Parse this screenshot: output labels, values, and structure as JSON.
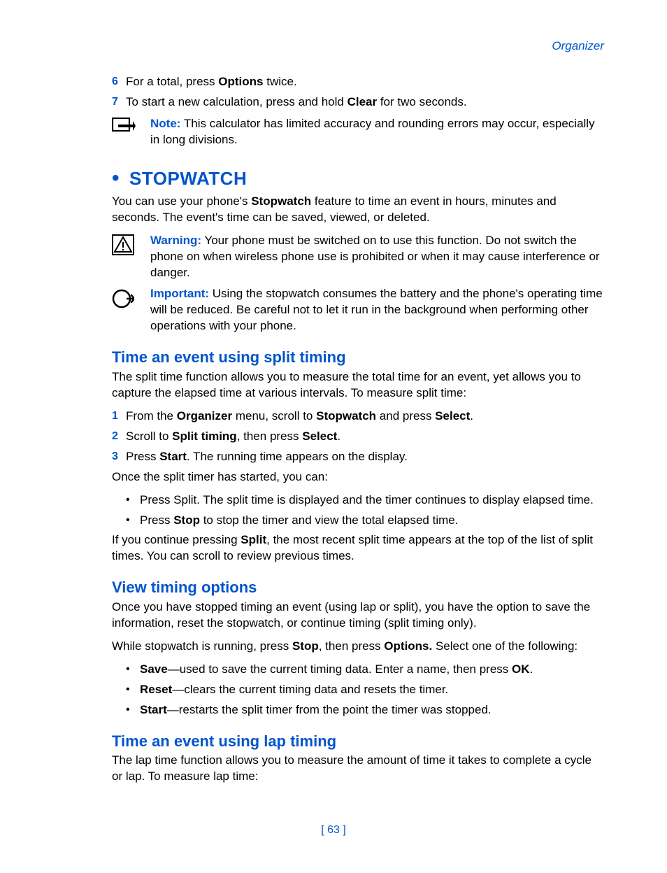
{
  "header": {
    "section": "Organizer"
  },
  "carryover": {
    "step6": {
      "n": "6",
      "a": "For a total, press ",
      "b": "Options",
      "c": " twice."
    },
    "step7": {
      "n": "7",
      "a": "To start a new calculation, press and hold ",
      "b": "Clear",
      "c": " for two seconds."
    },
    "note": {
      "label": "Note:",
      "text": " This calculator has limited accuracy and rounding errors may occur, especially in long divisions."
    }
  },
  "stopwatch": {
    "heading": "STOPWATCH",
    "intro": {
      "a": "You can use your phone's ",
      "b": "Stopwatch",
      "c": " feature to time an event in hours, minutes and seconds. The event's time can be saved, viewed, or deleted."
    },
    "warning": {
      "label": "Warning:",
      "text": " Your phone must be switched on to use this function. Do not switch the phone on when wireless phone use is prohibited or when it may cause interference or danger."
    },
    "important": {
      "label": "Important:",
      "text": " Using the stopwatch consumes the battery and the phone's operating time will be reduced. Be careful not to let it run in the background when performing other operations with your phone."
    }
  },
  "split": {
    "heading": "Time an event using split timing",
    "intro": "The split time function allows you to measure the total time for an event, yet allows you to capture the elapsed time at various intervals. To measure split time:",
    "step1": {
      "n": "1",
      "a": "From the ",
      "b": "Organizer",
      "c": " menu, scroll to ",
      "d": "Stopwatch",
      "e": " and press ",
      "f": "Select",
      "g": "."
    },
    "step2": {
      "n": "2",
      "a": "Scroll to ",
      "b": "Split timing",
      "c": ", then press ",
      "d": "Select",
      "e": "."
    },
    "step3": {
      "n": "3",
      "a": "Press ",
      "b": "Start",
      "c": ". The running time appears on the display."
    },
    "aftersteps": "Once the split timer has started, you can:",
    "bul1": "Press Split. The split time is displayed and the timer continues to display elapsed time.",
    "bul2": {
      "a": "Press ",
      "b": "Stop",
      "c": " to stop the timer and view the total elapsed time."
    },
    "afterbul": {
      "a": "If you continue pressing ",
      "b": "Split",
      "c": ", the most recent split time appears at the top of the list of split times. You can scroll to review previous times."
    }
  },
  "view": {
    "heading": "View timing options",
    "intro": "Once you have stopped timing an event (using lap or split), you have the option to save the information, reset the stopwatch, or continue timing (split timing only).",
    "lead": {
      "a": "While stopwatch is running, press ",
      "b": "Stop",
      "c": ", then press ",
      "d": "Options.",
      "e": " Select one of the following:"
    },
    "bul1": {
      "a": "Save",
      "b": "—used to save the current timing data. Enter a name, then press ",
      "c": "OK",
      "d": "."
    },
    "bul2": {
      "a": "Reset",
      "b": "—clears the current timing data and resets the timer."
    },
    "bul3": {
      "a": "Start",
      "b": "—restarts the split timer from the point the timer was stopped."
    }
  },
  "lap": {
    "heading": "Time an event using lap timing",
    "intro": "The lap time function allows you to measure the amount of time it takes to complete a cycle or lap. To measure lap time:"
  },
  "footer": {
    "page": "[ 63 ]"
  }
}
